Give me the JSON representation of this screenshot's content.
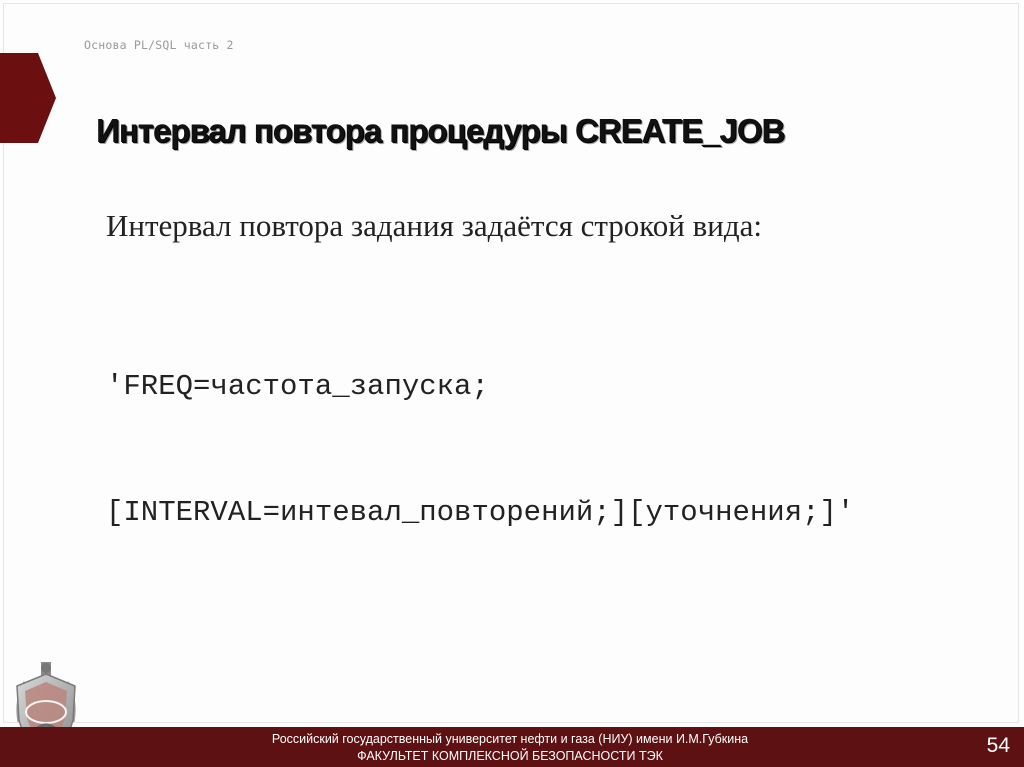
{
  "header": {
    "breadcrumb": "Основа PL/SQL часть 2"
  },
  "slide": {
    "title": "Интервал повтора процедуры CREATE_JOB",
    "intro": "Интервал повтора задания задаётся строкой вида:",
    "code_lines": [
      "'FREQ=частота_запуска;",
      "[INTERVAL=интевал_повторений;][уточнения;]'"
    ]
  },
  "footer": {
    "university": "Российский государственный университет нефти и газа (НИУ) имени И.М.Губкина",
    "faculty": "ФАКУЛЬТЕТ КОМПЛЕКСНОЙ БЕЗОПАСНОСТИ ТЭК",
    "page_number": "54"
  },
  "colors": {
    "accent": "#6b0f10",
    "footer_bg": "#5e1112",
    "text": "#222222"
  },
  "icons": {
    "chevron": "chevron-right-icon",
    "emblem": "faculty-emblem-icon"
  }
}
